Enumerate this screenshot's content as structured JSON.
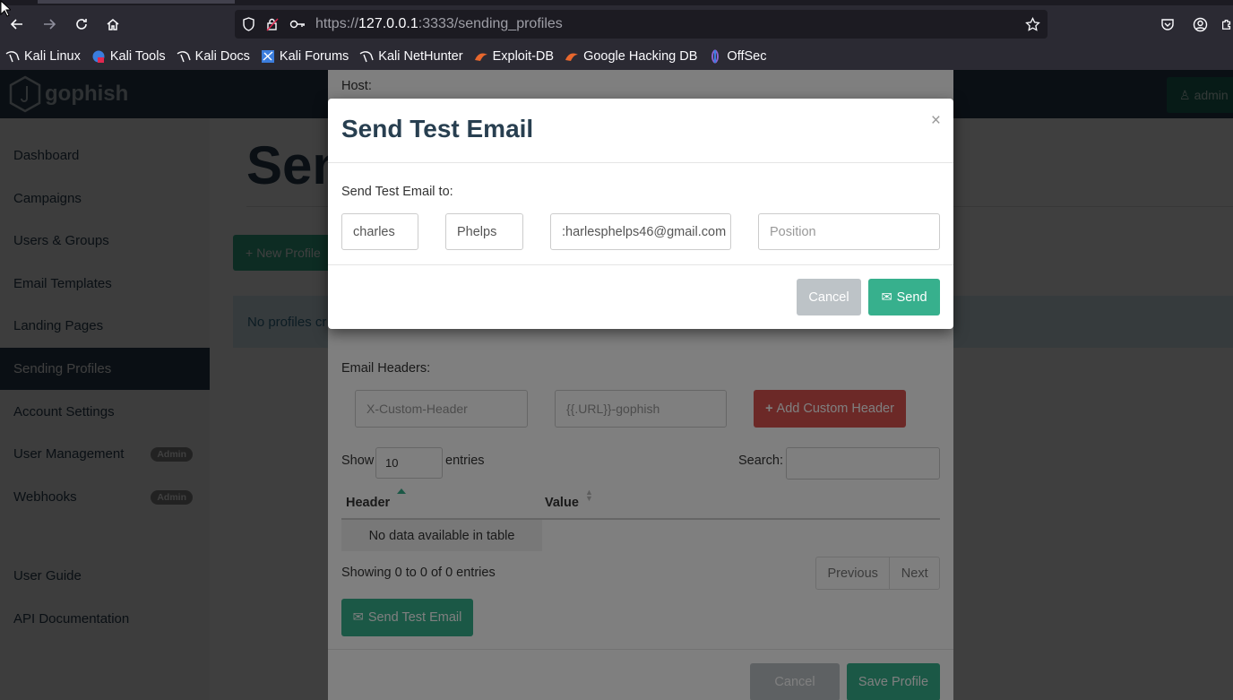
{
  "browser": {
    "url_prefix": "https://",
    "url_host": "127.0.0.1",
    "url_rest": ":3333/sending_profiles",
    "bookmarks": [
      {
        "label": "Kali Linux",
        "icon": "kali-dragon-icon"
      },
      {
        "label": "Kali Tools",
        "icon": "kali-tools-icon"
      },
      {
        "label": "Kali Docs",
        "icon": "kali-dragon-icon"
      },
      {
        "label": "Kali Forums",
        "icon": "kali-forums-icon"
      },
      {
        "label": "Kali NetHunter",
        "icon": "kali-dragon-icon"
      },
      {
        "label": "Exploit-DB",
        "icon": "exploit-db-icon"
      },
      {
        "label": "Google Hacking DB",
        "icon": "exploit-db-icon"
      },
      {
        "label": "OffSec",
        "icon": "offsec-icon"
      }
    ]
  },
  "app": {
    "logo_text": "gophish",
    "admin_label": "admin",
    "page_title": "Sen",
    "new_profile_label": "New Profile",
    "no_profiles_text": "No profiles cr"
  },
  "sidebar": {
    "items": [
      {
        "label": "Dashboard"
      },
      {
        "label": "Campaigns"
      },
      {
        "label": "Users & Groups"
      },
      {
        "label": "Email Templates"
      },
      {
        "label": "Landing Pages"
      },
      {
        "label": "Sending Profiles"
      },
      {
        "label": "Account Settings"
      },
      {
        "label": "User Management",
        "badge": "Admin"
      },
      {
        "label": "Webhooks",
        "badge": "Admin"
      },
      {
        "label": "User Guide"
      },
      {
        "label": "API Documentation"
      }
    ]
  },
  "profile_modal": {
    "host_label": "Host:",
    "email_headers_label": "Email Headers:",
    "header_placeholder": "X-Custom-Header",
    "value_placeholder": "{{.URL}}-gophish",
    "add_header_label": "Add Custom Header",
    "show_label": "Show",
    "entries_value": "10",
    "entries_label": "entries",
    "search_label": "Search:",
    "col_header": "Header",
    "col_value": "Value",
    "empty_text": "No data available in table",
    "showing_text": "Showing 0 to 0 of 0 entries",
    "prev_label": "Previous",
    "next_label": "Next",
    "send_test_label": "Send Test Email",
    "cancel_label": "Cancel",
    "save_label": "Save Profile"
  },
  "test_modal": {
    "title": "Send Test Email",
    "close": "×",
    "to_label": "Send Test Email to:",
    "first_name": "charles",
    "last_name": "Phelps",
    "email": ":harlesphelps46@gmail.com",
    "position_placeholder": "Position",
    "cancel_label": "Cancel",
    "send_label": "Send"
  },
  "colors": {
    "nav": "#283f50",
    "primary_green": "#37b08d",
    "danger_red": "#d9534f"
  }
}
